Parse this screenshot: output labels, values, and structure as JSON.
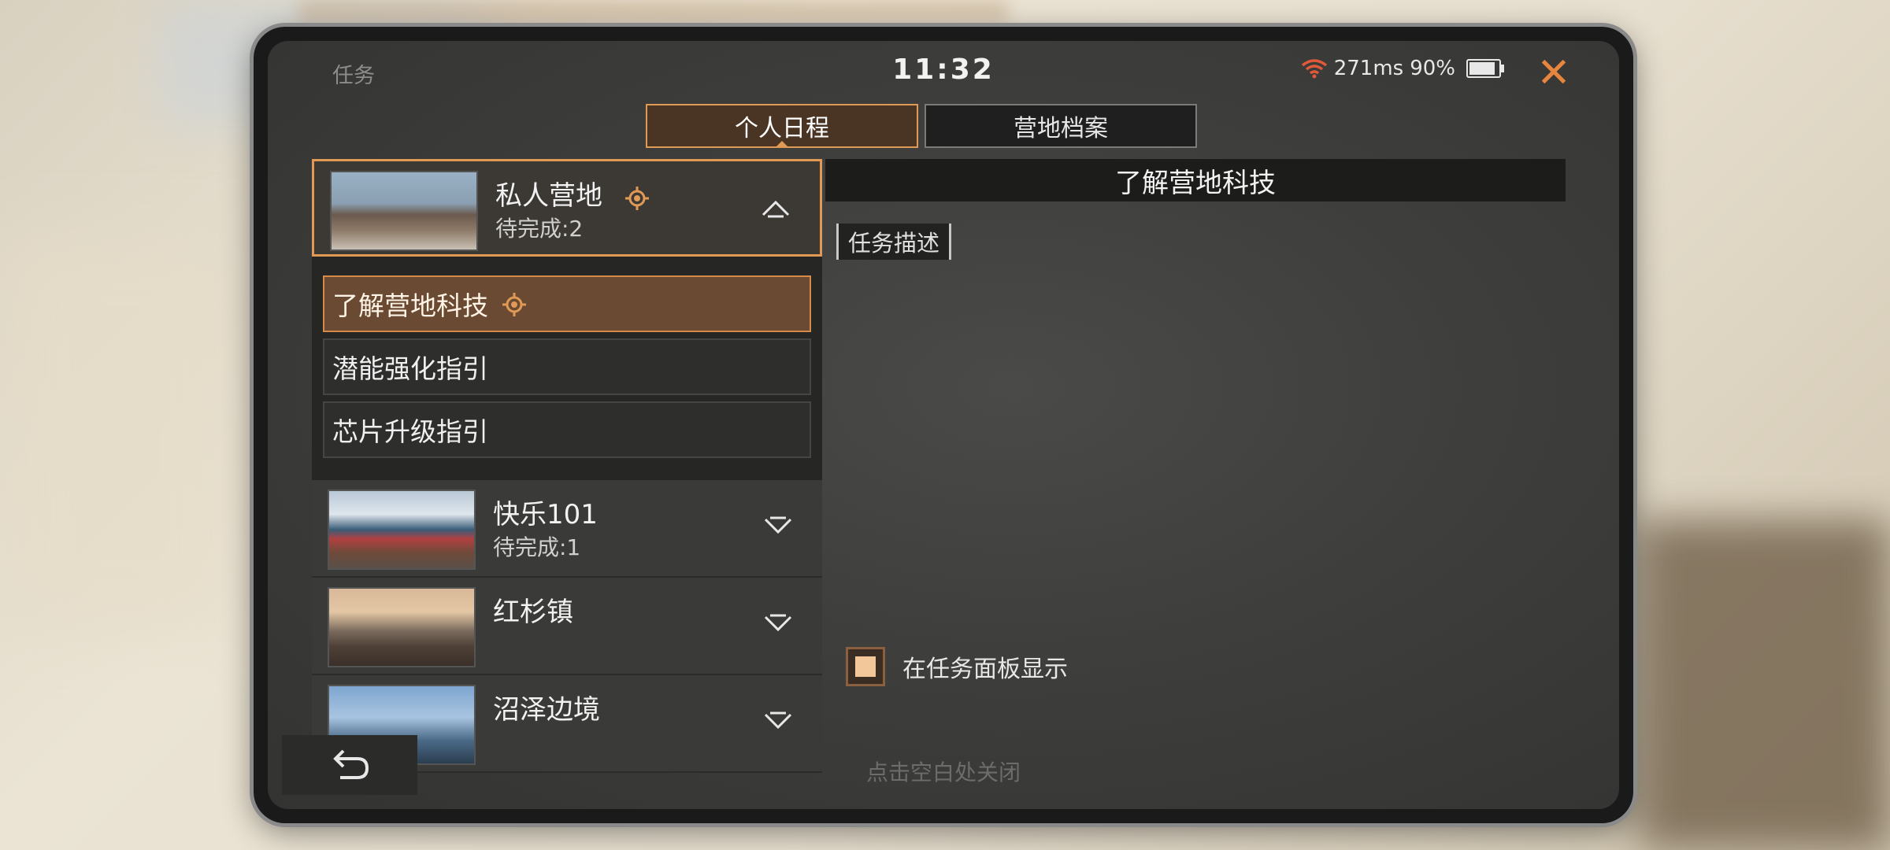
{
  "header": {
    "title": "任务",
    "clock": "11:32",
    "ping": "271ms",
    "battery": "90%"
  },
  "tabs": [
    {
      "label": "个人日程",
      "active": true
    },
    {
      "label": "营地档案",
      "active": false
    }
  ],
  "camps": [
    {
      "name": "私人营地",
      "pending": "待完成:2",
      "expanded": true,
      "selected": true
    },
    {
      "name": "快乐101",
      "pending": "待完成:1",
      "expanded": false
    },
    {
      "name": "红杉镇",
      "pending": "",
      "expanded": false
    },
    {
      "name": "沼泽边境",
      "pending": "",
      "expanded": false
    }
  ],
  "tasks": [
    {
      "label": "了解营地科技",
      "active": true
    },
    {
      "label": "潜能强化指引",
      "active": false
    },
    {
      "label": "芯片升级指引",
      "active": false
    }
  ],
  "detail": {
    "title": "了解营地科技",
    "section_label": "任务描述",
    "checkbox_label": "在任务面板显示",
    "checkbox_checked": true
  },
  "footer": {
    "hint": "点击空白处关闭"
  },
  "colors": {
    "accent": "#e09a55",
    "close": "#e6853e"
  }
}
